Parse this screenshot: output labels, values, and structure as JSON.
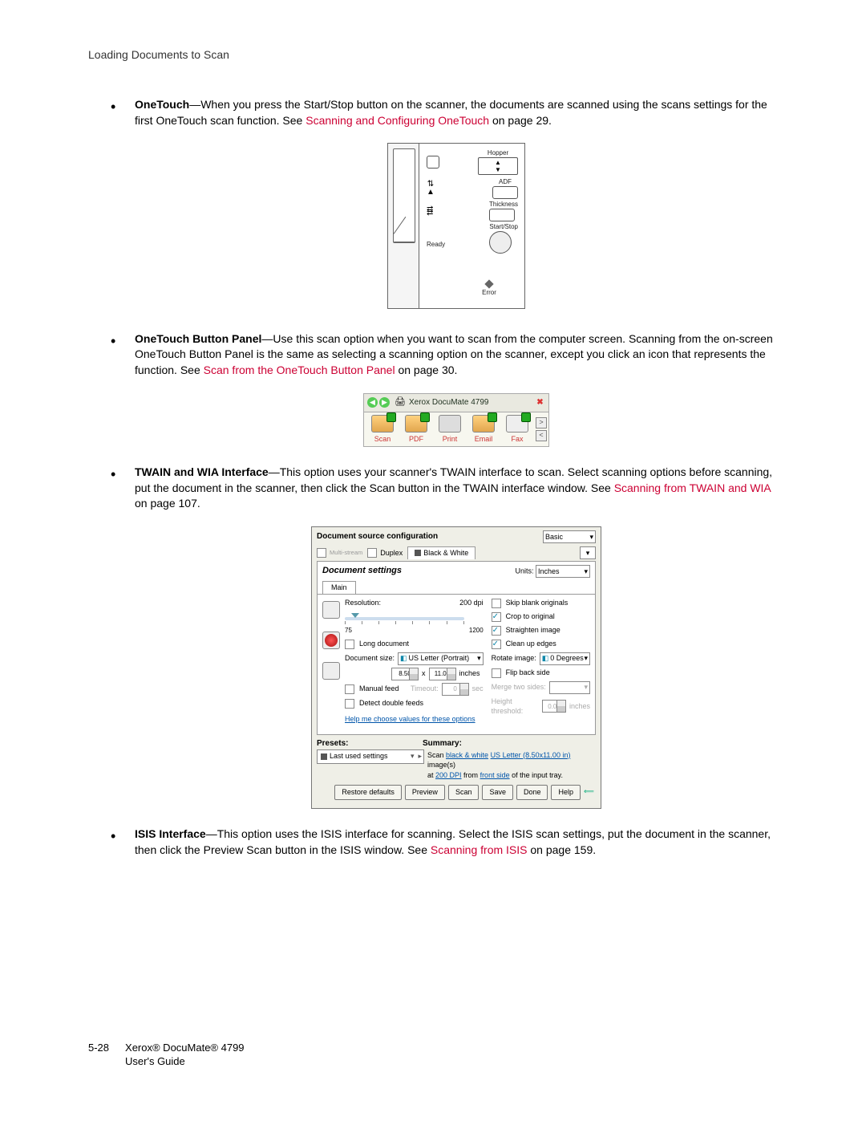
{
  "header": {
    "title": "Loading Documents to Scan"
  },
  "footer": {
    "pagenum": "5-28",
    "line1": "Xerox® DocuMate® 4799",
    "line2": "User's Guide"
  },
  "items": [
    {
      "term": "OneTouch",
      "body": "—When you press the Start/Stop button on the scanner, the documents are scanned using the scans settings for the first OneTouch scan function. See ",
      "link": "Scanning and Configuring OneTouch",
      "tail": " on page 29."
    },
    {
      "term": "OneTouch Button Panel",
      "body": "—Use this scan option when you want to scan from the computer screen. Scanning from the on-screen OneTouch Button Panel is the same as selecting a scanning option on the scanner, except you click an icon that represents the function. See ",
      "link": "Scan from the OneTouch Button Panel",
      "tail": " on page 30."
    },
    {
      "term": "TWAIN and WIA Interface",
      "body": "—This option uses your scanner's TWAIN interface to scan. Select scanning options before scanning, put the document in the scanner, then click the Scan button in the TWAIN interface window. See ",
      "link": "Scanning from TWAIN and WIA",
      "tail": " on page 107."
    },
    {
      "term": "ISIS Interface",
      "body": "—This option uses the ISIS interface for scanning. Select the ISIS scan settings, put the document in the scanner, then click the Preview Scan button in the ISIS window. See ",
      "link": "Scanning from ISIS",
      "tail": " on page 159."
    }
  ],
  "scanner_diagram": {
    "hopper": "Hopper",
    "hopper_up": "▲",
    "hopper_down": "▼",
    "adf": "ADF",
    "thickness": "Thickness",
    "startstop": "Start/Stop",
    "ready": "Ready",
    "error": "Error"
  },
  "onetouch_panel": {
    "title": "Xerox DocuMate 4799",
    "items": [
      "Scan",
      "PDF",
      "Print",
      "Email",
      "Fax"
    ]
  },
  "twain": {
    "top_title": "Document source configuration",
    "top_select": "Basic",
    "multi": "Multi-stream",
    "duplex": "Duplex",
    "bw_tab": "Black & White",
    "section_title": "Document settings",
    "units_label": "Units:",
    "units_value": "Inches",
    "main_tab": "Main",
    "resolution": "Resolution:",
    "res_value": "200 dpi",
    "res_min": "75",
    "res_max": "1200",
    "long_doc": "Long document",
    "doc_size": "Document size:",
    "doc_size_value": "US Letter (Portrait)",
    "w": "8.50",
    "x": "x",
    "h": "11.00",
    "size_unit": "inches",
    "manual_feed": "Manual feed",
    "timeout": "Timeout:",
    "timeout_val": "0",
    "timeout_unit": "sec",
    "detect_dbl": "Detect double feeds",
    "help_link": "Help me choose values for these options",
    "chk_skip": "Skip blank originals",
    "chk_crop": "Crop to original",
    "chk_straight": "Straighten image",
    "chk_clean": "Clean up edges",
    "rotate": "Rotate image:",
    "rotate_val": "0 Degrees",
    "flip": "Flip back side",
    "merge": "Merge two sides:",
    "height_th": "Height threshold:",
    "height_val": "0.00",
    "height_unit": "inches",
    "presets": "Presets:",
    "summary": "Summary:",
    "preset_value": "Last used settings",
    "summary_line1_a": "Scan ",
    "summary_line1_b": "black & white",
    "summary_line1_c": " ",
    "summary_line1_d": "US Letter (8.50x11.00 in)",
    "summary_line1_e": " image(s)",
    "summary_line2_a": "at ",
    "summary_line2_b": "200 DPI",
    "summary_line2_c": " from ",
    "summary_line2_d": "front side",
    "summary_line2_e": " of the input tray.",
    "buttons": [
      "Restore defaults",
      "Preview",
      "Scan",
      "Save",
      "Done",
      "Help"
    ]
  }
}
